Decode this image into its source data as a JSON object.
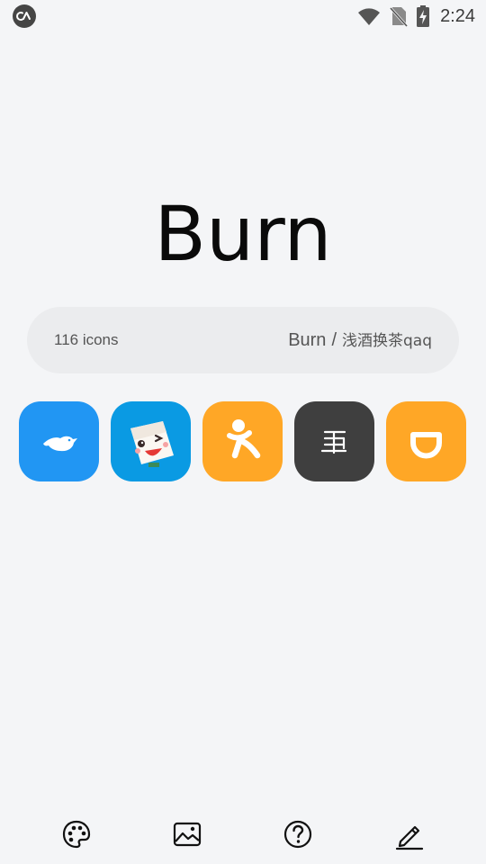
{
  "status_bar": {
    "time": "2:24",
    "left_icon": "notification-app-icon",
    "icons": [
      "wifi-icon",
      "no-sim-icon",
      "battery-charging-icon"
    ]
  },
  "app": {
    "title": "Burn"
  },
  "info": {
    "icon_count": "116 icons",
    "pack_name": "Burn",
    "separator": "/",
    "author": "浅酒换茶qaq"
  },
  "preview_icons": [
    {
      "icon": "bird-icon",
      "color": "#2196f3"
    },
    {
      "icon": "cartoon-face-icon",
      "color": "#0a9ae3"
    },
    {
      "icon": "runner-icon",
      "color": "#ffa726"
    },
    {
      "icon": "text-glyph-icon",
      "color": "#3f3f3f"
    },
    {
      "icon": "didi-icon",
      "color": "#ffa726"
    }
  ],
  "bottom_nav": [
    "palette-icon",
    "wallpaper-icon",
    "help-icon",
    "edit-icon"
  ],
  "colors": {
    "background": "#f4f5f7",
    "pill": "#ebecee",
    "text": "#0a0a0a"
  }
}
